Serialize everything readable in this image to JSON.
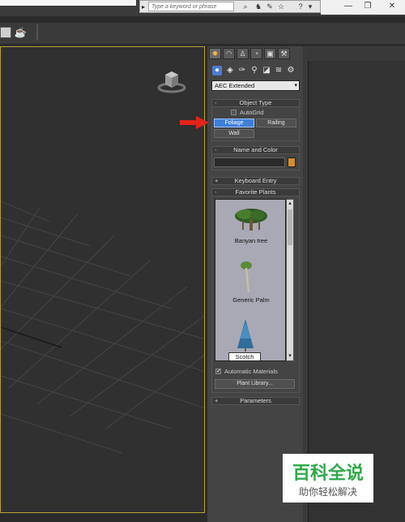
{
  "search": {
    "placeholder": "Type a keyword or phrase"
  },
  "window_controls": {
    "minimize": "—",
    "restore": "❐",
    "close": "✕"
  },
  "dropdown": {
    "value": "AEC Extended"
  },
  "object_type": {
    "title": "Object Type",
    "autogrid_label": "AutoGrid",
    "buttons": [
      "Foliage",
      "Railing",
      "Wall"
    ]
  },
  "name_and_color": {
    "title": "Name and Color",
    "swatch_color": "#d78f2c"
  },
  "keyboard_entry": {
    "title": "Keyboard Entry",
    "sign": "+"
  },
  "favorite_plants": {
    "title": "Favorite Plants",
    "sign": "-",
    "plants": [
      "Banyan tree",
      "Generic Palm",
      "Scotch Pine"
    ],
    "automatic_materials_label": "Automatic Materials",
    "plant_library_label": "Plant Library..."
  },
  "parameters": {
    "title": "Parameters",
    "sign": "+"
  },
  "rollout_minus": "-",
  "watermark": {
    "title": "百科全说",
    "subtitle": "助你轻松解决"
  }
}
